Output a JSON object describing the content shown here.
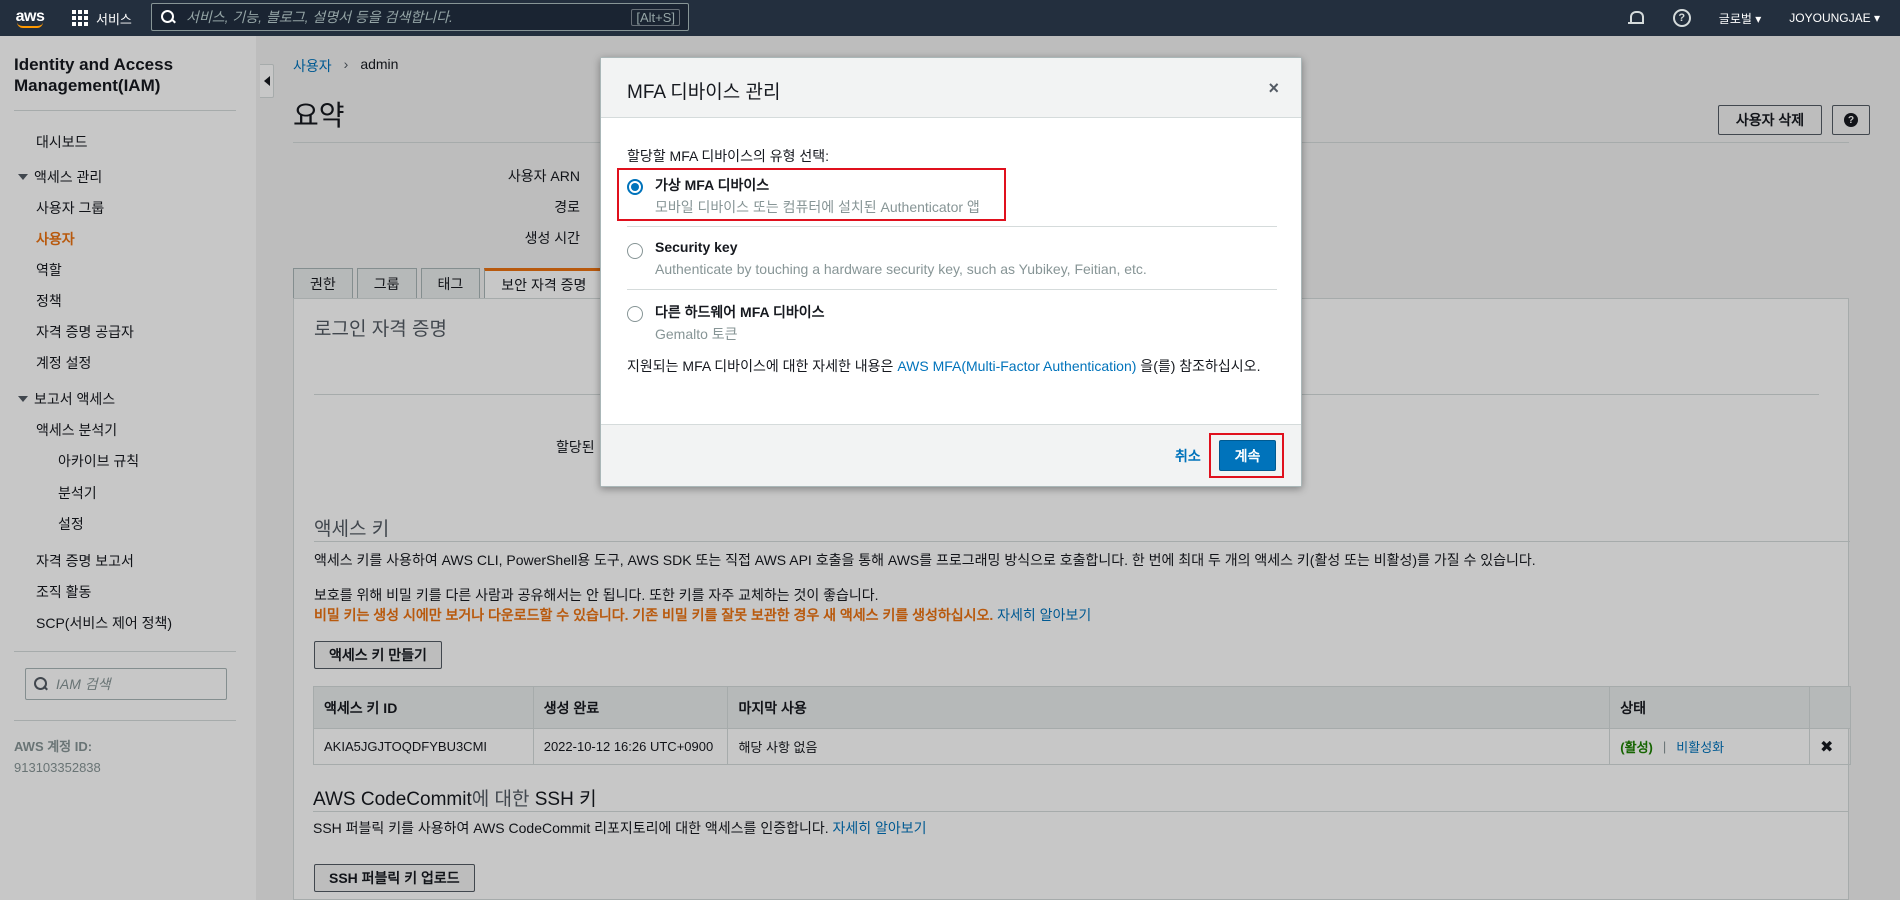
{
  "topnav": {
    "logo": "aws",
    "services_label": "서비스",
    "search_placeholder": "서비스, 기능, 블로그, 설명서 등을 검색합니다.",
    "search_shortcut": "[Alt+S]",
    "region_label": "글로벌",
    "account_label": "JOYOUNGJAE"
  },
  "sidebar": {
    "title": "Identity and Access Management(IAM)",
    "dashboard": "대시보드",
    "access_mgmt": "액세스 관리",
    "user_groups": "사용자 그룹",
    "users": "사용자",
    "roles": "역할",
    "policies": "정책",
    "identity_providers": "자격 증명 공급자",
    "account_settings": "계정 설정",
    "report_access": "보고서 액세스",
    "access_analyzer": "액세스 분석기",
    "archive_rules": "아카이브 규칙",
    "analyzers": "분석기",
    "settings": "설정",
    "credential_report": "자격 증명 보고서",
    "org_activity": "조직 활동",
    "scp": "SCP(서비스 제어 정책)",
    "search_placeholder": "IAM 검색",
    "account_id_label": "AWS 계정 ID:",
    "account_id": "913103352838"
  },
  "main": {
    "breadcrumb_users": "사용자",
    "breadcrumb_current": "admin",
    "page_title": "요약",
    "delete_user_button": "사용자 삭제",
    "summary": {
      "user_arn_label": "사용자 ARN",
      "path_label": "경로",
      "created_label": "생성 시간"
    },
    "tabs": [
      "권한",
      "그룹",
      "태그",
      "보안 자격 증명"
    ],
    "login_credentials_heading": "로그인 자격 증명",
    "assigned_mfa_partial": "할당된",
    "access_keys_heading": "액세스 키",
    "access_keys_desc": "액세스 키를 사용하여 AWS CLI, PowerShell용 도구, AWS SDK 또는 직접 AWS API 호출을 통해 AWS를 프로그래밍 방식으로 호출합니다. 한 번에 최대 두 개의 액세스 키(활성 또는 비활성)를 가질 수 있습니다.",
    "access_keys_protect": "보호를 위해 비밀 키를 다른 사람과 공유해서는 안 됩니다. 또한 키를 자주 교체하는 것이 좋습니다.",
    "access_keys_warning": "비밀 키는 생성 시에만 보거나 다운로드할 수 있습니다. 기존 비밀 키를 잘못 보관한 경우 새 액세스 키를 생성하십시오.",
    "learn_more": "자세히 알아보기",
    "create_access_key_button": "액세스 키 만들기",
    "table": {
      "headers": [
        "액세스 키 ID",
        "생성 완료",
        "마지막 사용",
        "상태"
      ],
      "row": {
        "key_id": "AKIA5JGJTOQDFYBU3CMI",
        "created": "2022-10-12 16:26 UTC+0900",
        "last_used": "해당 사항 없음",
        "status": "(활성)",
        "sep": "|",
        "deactivate": "비활성화"
      }
    },
    "codecommit_heading_a": "AWS CodeCommit",
    "codecommit_heading_b": "에 대한",
    "codecommit_heading_c": "SSH 키",
    "codecommit_desc": "SSH 퍼블릭 키를 사용하여 AWS CodeCommit 리포지토리에 대한 액세스를 인증합니다.",
    "upload_ssh_button": "SSH 퍼블릭 키 업로드"
  },
  "modal": {
    "title": "MFA 디바이스 관리",
    "prompt": "할당할 MFA 디바이스의 유형 선택:",
    "options": [
      {
        "title": "가상 MFA 디바이스",
        "desc": "모바일 디바이스 또는 컴퓨터에 설치된 Authenticator 앱",
        "selected": true
      },
      {
        "title": "Security key",
        "desc": "Authenticate by touching a hardware security key, such as Yubikey, Feitian, etc.",
        "selected": false
      },
      {
        "title": "다른 하드웨어 MFA 디바이스",
        "desc": "Gemalto 토큰",
        "selected": false
      }
    ],
    "note_prefix": "지원되는 MFA 디바이스에 대한 자세한 내용은 ",
    "note_link": "AWS MFA(Multi-Factor Authentication)",
    "note_suffix": " 을(를) 참조하십시오.",
    "cancel": "취소",
    "continue": "계속"
  },
  "colors": {
    "nav_bg": "#232f3e",
    "accent_orange": "#ec7211",
    "link_blue": "#0073bb",
    "highlight_red": "#e0101d",
    "active_green": "#1d8102"
  }
}
